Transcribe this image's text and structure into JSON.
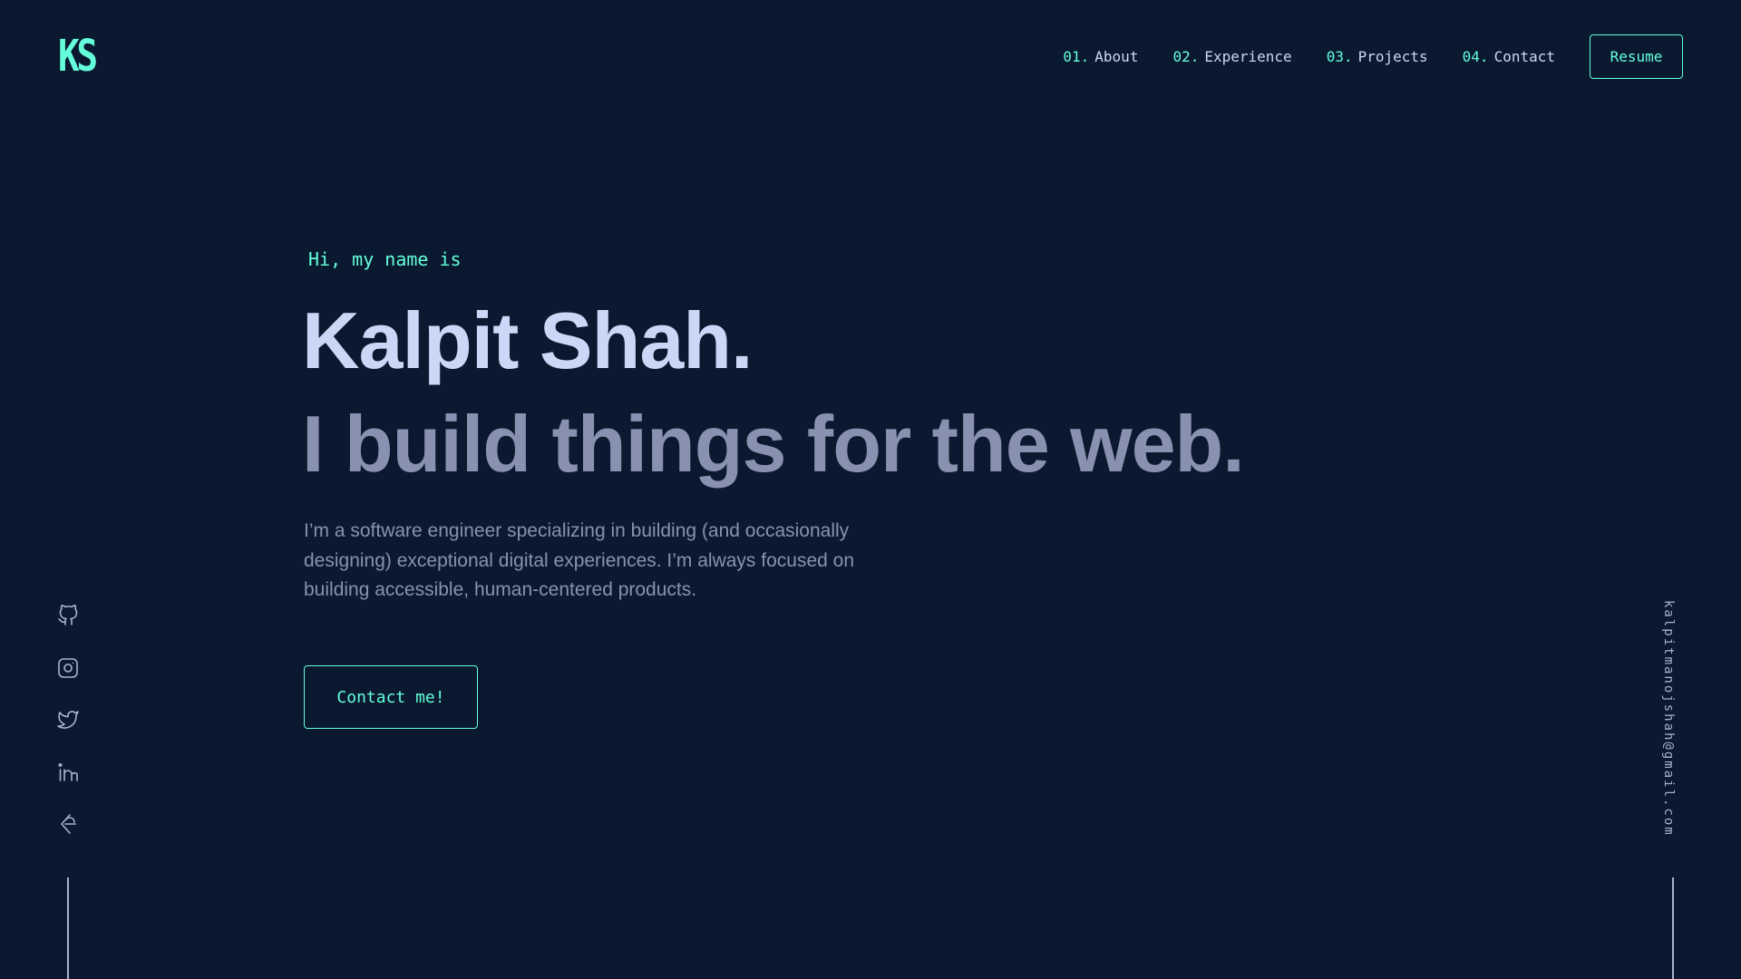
{
  "header": {
    "logo": "KS",
    "nav": [
      {
        "num": "01.",
        "label": "About"
      },
      {
        "num": "02.",
        "label": "Experience"
      },
      {
        "num": "03.",
        "label": "Projects"
      },
      {
        "num": "04.",
        "label": "Contact"
      }
    ],
    "resume_label": "Resume"
  },
  "hero": {
    "greeting": "Hi, my name is",
    "name": "Kalpit Shah.",
    "tagline": "I build things for the web.",
    "intro_lines": [
      "I’m a software engineer specializing in building (and occasionally",
      "designing) exceptional digital experiences. I’m always focused on",
      "building accessible, human-centered products."
    ],
    "contact_label": "Contact me!"
  },
  "social": {
    "icons": [
      "github-icon",
      "instagram-icon",
      "twitter-icon",
      "linkedin-icon",
      "codechef-icon"
    ]
  },
  "email": "kalpitmanojshah@gmail.com",
  "colors": {
    "background": "#0a192f",
    "accent": "#64ffda",
    "heading": "#ccd6f6",
    "text": "#8892b0",
    "icon": "#a8b2d1"
  }
}
